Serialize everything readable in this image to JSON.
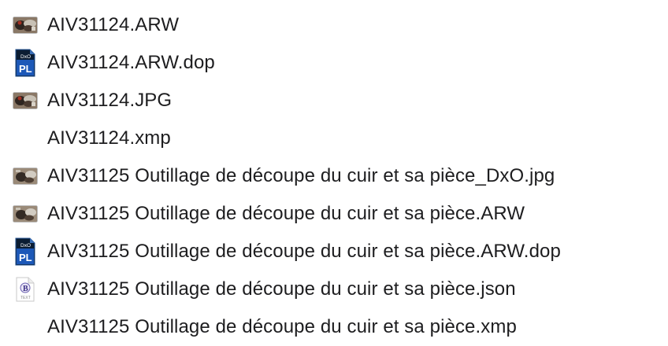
{
  "files": [
    {
      "name": "AIV31124.ARW",
      "icon": "raw-photo-thumbnail-icon"
    },
    {
      "name": "AIV31124.ARW.dop",
      "icon": "dxo-pl-document-icon"
    },
    {
      "name": "AIV31124.JPG",
      "icon": "jpg-photo-thumbnail-icon"
    },
    {
      "name": "AIV31124.xmp",
      "icon": "none"
    },
    {
      "name": "AIV31125 Outillage de découpe du cuir et sa pièce_DxO.jpg",
      "icon": "jpg-photo-thumbnail-icon"
    },
    {
      "name": "AIV31125 Outillage de découpe du cuir et sa pièce.ARW",
      "icon": "raw-photo-thumbnail-icon"
    },
    {
      "name": "AIV31125 Outillage de découpe du cuir et sa pièce.ARW.dop",
      "icon": "dxo-pl-document-icon"
    },
    {
      "name": "AIV31125 Outillage de découpe du cuir et sa pièce.json",
      "icon": "bbedit-text-document-icon",
      "icon_text": "TEXT"
    },
    {
      "name": "AIV31125 Outillage de découpe du cuir et sa pièce.xmp",
      "icon": "none"
    }
  ],
  "dxo_icon": {
    "top_text": "DxO",
    "bottom_text": "PL"
  },
  "colors": {
    "text": "#1d1d1f",
    "background": "#ffffff",
    "dxo_blue": "#2a6fd6",
    "dxo_dark": "#0b1d33"
  }
}
